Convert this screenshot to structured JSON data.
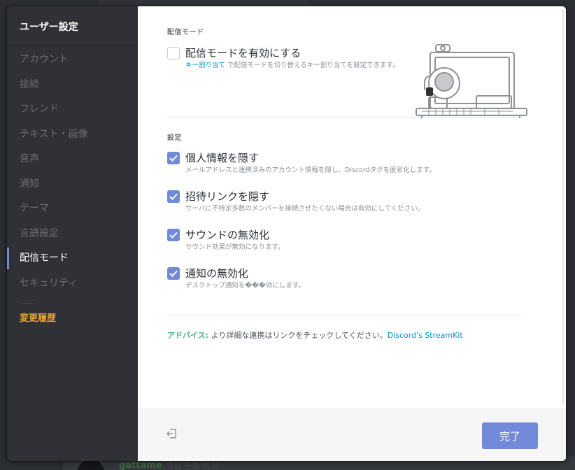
{
  "background_chat": {
    "username": "gattame",
    "timestamp": "今日 午後 時 分"
  },
  "sidebar": {
    "title": "ユーザー設定",
    "items": [
      {
        "label": "アカウント",
        "name": "account"
      },
      {
        "label": "接続",
        "name": "connections"
      },
      {
        "label": "フレンド",
        "name": "friends"
      },
      {
        "label": "テキスト・画像",
        "name": "text-images"
      },
      {
        "label": "音声",
        "name": "voice"
      },
      {
        "label": "通知",
        "name": "notifications"
      },
      {
        "label": "テーマ",
        "name": "theme"
      },
      {
        "label": "言語設定",
        "name": "language"
      },
      {
        "label": "配信モード",
        "name": "streamer-mode"
      },
      {
        "label": "セキュリティ",
        "name": "security"
      }
    ],
    "active_index": 8,
    "changelog_label": "変更履歴"
  },
  "streamer": {
    "section_title": "配信モード",
    "enable_label": "配信モードを有効にする",
    "enable_checked": false,
    "keybind_link": "キー割り当て",
    "keybind_desc": " で配信モードを切り替えるキー割り当てを設定できます。"
  },
  "settings": {
    "section_title": "設定",
    "options": [
      {
        "label": "個人情報を隠す",
        "desc": "メールアドレスと連携済みのアカウント情報を隠し、Discordタグを匿名化します。",
        "checked": true,
        "name": "hide-personal-info"
      },
      {
        "label": "招待リンクを隠す",
        "desc": "サーバに不特定多数のメンバーを接続させたくない場合は有効にしてください。",
        "checked": true,
        "name": "hide-invite-links"
      },
      {
        "label": "サウンドの無効化",
        "desc": "サウンド効果が無効になります。",
        "checked": true,
        "name": "disable-sounds"
      },
      {
        "label": "通知の無効化",
        "desc": "デスクトップ通知を���効にします。",
        "checked": true,
        "name": "disable-notifications"
      }
    ]
  },
  "advice": {
    "tag": "アドバイス:",
    "text": " より詳細な連携はリンクをチェックしてください。",
    "link": "Discord's StreamKit"
  },
  "footer": {
    "done_label": "完了"
  },
  "colors": {
    "accent": "#7289da",
    "advice": "#43b581",
    "link": "#0096cf",
    "changelog": "#e9a62d"
  }
}
